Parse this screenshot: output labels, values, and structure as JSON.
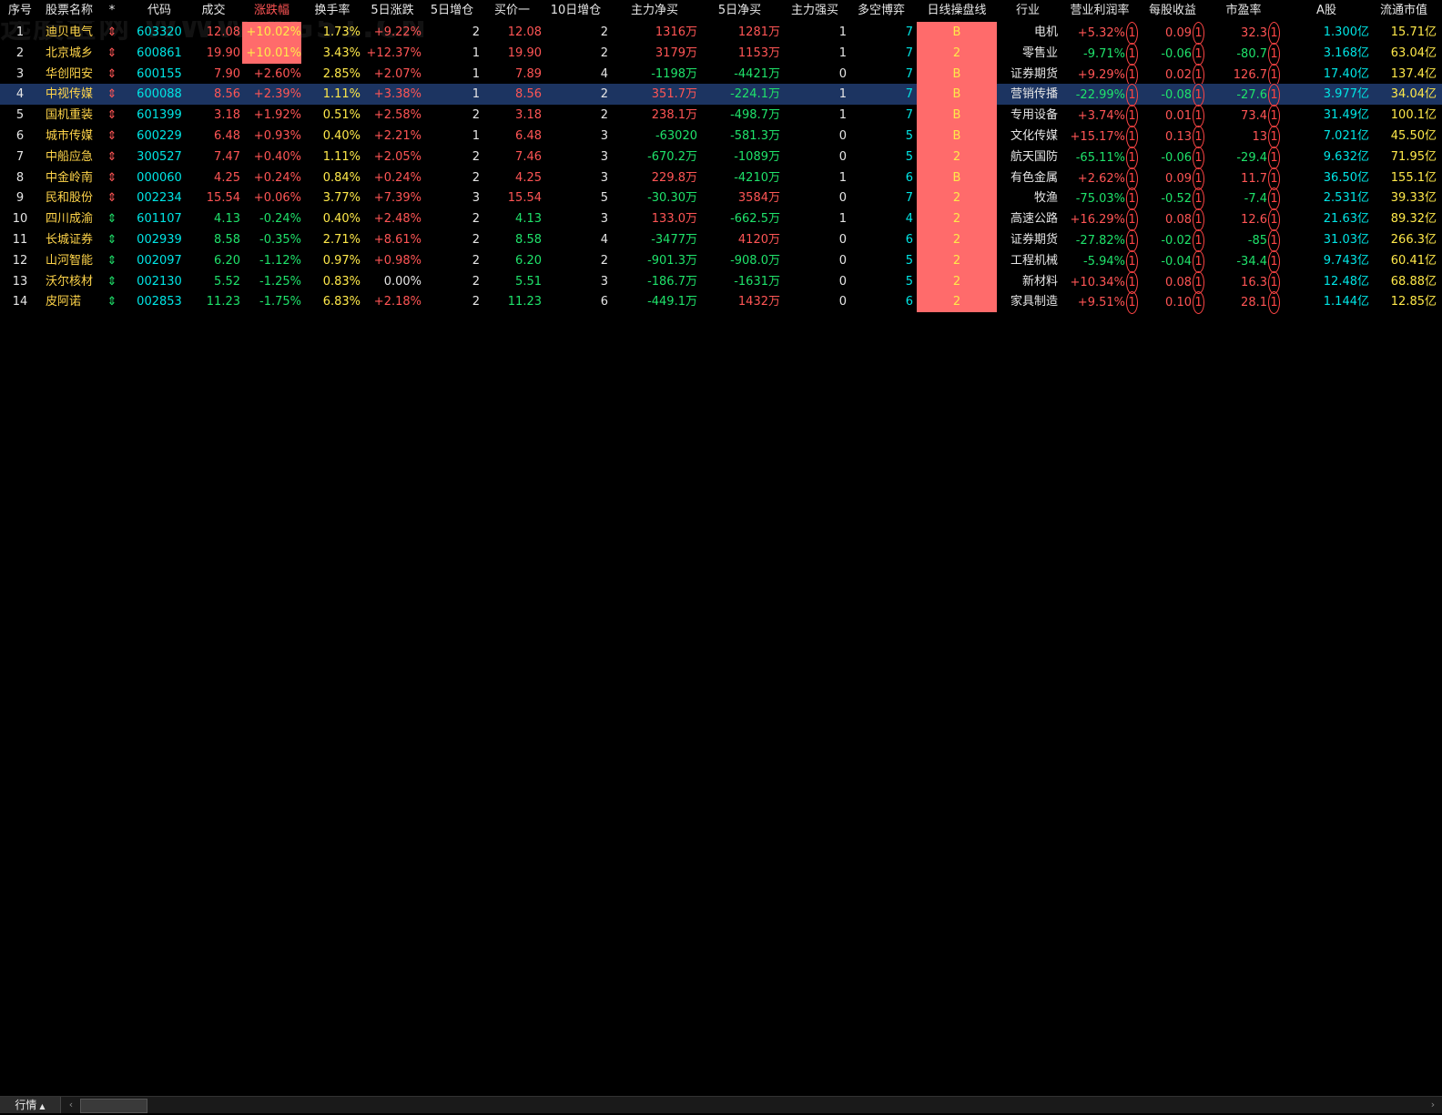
{
  "watermark": "选股宝网 WWW.XG51.CN",
  "headers": {
    "idx": "序号",
    "name": "股票名称",
    "star": "*",
    "code": "代码",
    "price": "成交",
    "chg": "涨跌幅",
    "turnover": "换手率",
    "chg5d": "5日涨跌",
    "add5d": "5日增仓",
    "bid1": "买价一",
    "add10d": "10日增仓",
    "main_net": "主力净买",
    "main_net5": "5日净买",
    "main_strong": "主力强买",
    "duokong": "多空博弈",
    "daily_line": "日线操盘线",
    "industry": "行业",
    "profit": "营业利润率",
    "eps": "每股收益",
    "pe": "市盈率",
    "a_share": "A股",
    "mkt_value": "流通市值"
  },
  "colors": {
    "up": "#ff5555",
    "down": "#1fe36b",
    "flat": "#e6e6e6",
    "highlight_bg": "#ff6b6b",
    "selected_row": "#1c3461"
  },
  "rows": [
    {
      "idx": "1",
      "name": "迪贝电气",
      "star": "⇕",
      "code": "603320",
      "price": "12.08",
      "chg": "+10.02%",
      "turnover": "1.73%",
      "chg5d": "+9.22%",
      "add5d": "2",
      "bid1": "12.08",
      "add10d": "2",
      "main_net": "1316万",
      "main_net5": "1281万",
      "main_strong": "1",
      "duokong": "7",
      "daily_line": "B",
      "industry": "电机",
      "profit": "+5.32%",
      "eps": "0.09",
      "pe": "32.3",
      "a_share": "1.300亿",
      "mkt_value": "15.71亿",
      "dir": "up",
      "hot": true
    },
    {
      "idx": "2",
      "name": "北京城乡",
      "star": "⇕",
      "code": "600861",
      "price": "19.90",
      "chg": "+10.01%",
      "turnover": "3.43%",
      "chg5d": "+12.37%",
      "add5d": "1",
      "bid1": "19.90",
      "add10d": "2",
      "main_net": "3179万",
      "main_net5": "1153万",
      "main_strong": "1",
      "duokong": "7",
      "daily_line": "2",
      "industry": "零售业",
      "profit": "-9.71%",
      "eps": "-0.06",
      "pe": "-80.7",
      "a_share": "3.168亿",
      "mkt_value": "63.04亿",
      "dir": "up",
      "hot": true
    },
    {
      "idx": "3",
      "name": "华创阳安",
      "star": "⇕",
      "code": "600155",
      "price": "7.90",
      "chg": "+2.60%",
      "turnover": "2.85%",
      "chg5d": "+2.07%",
      "add5d": "1",
      "bid1": "7.89",
      "add10d": "4",
      "main_net": "-1198万",
      "main_net5": "-4421万",
      "main_strong": "0",
      "duokong": "7",
      "daily_line": "B",
      "industry": "证券期货",
      "profit": "+9.29%",
      "eps": "0.02",
      "pe": "126.7",
      "a_share": "17.40亿",
      "mkt_value": "137.4亿",
      "dir": "up",
      "hot": false
    },
    {
      "idx": "4",
      "name": "中视传媒",
      "star": "⇕",
      "code": "600088",
      "price": "8.56",
      "chg": "+2.39%",
      "turnover": "1.11%",
      "chg5d": "+3.38%",
      "add5d": "1",
      "bid1": "8.56",
      "add10d": "2",
      "main_net": "351.7万",
      "main_net5": "-224.1万",
      "main_strong": "1",
      "duokong": "7",
      "daily_line": "B",
      "industry": "营销传播",
      "profit": "-22.99%",
      "eps": "-0.08",
      "pe": "-27.6",
      "a_share": "3.977亿",
      "mkt_value": "34.04亿",
      "dir": "up",
      "hot": false,
      "selected": true
    },
    {
      "idx": "5",
      "name": "国机重装",
      "star": "⇕",
      "code": "601399",
      "price": "3.18",
      "chg": "+1.92%",
      "turnover": "0.51%",
      "chg5d": "+2.58%",
      "add5d": "2",
      "bid1": "3.18",
      "add10d": "2",
      "main_net": "238.1万",
      "main_net5": "-498.7万",
      "main_strong": "1",
      "duokong": "7",
      "daily_line": "B",
      "industry": "专用设备",
      "profit": "+3.74%",
      "eps": "0.01",
      "pe": "73.4",
      "a_share": "31.49亿",
      "mkt_value": "100.1亿",
      "dir": "up",
      "hot": false
    },
    {
      "idx": "6",
      "name": "城市传媒",
      "star": "⇕",
      "code": "600229",
      "price": "6.48",
      "chg": "+0.93%",
      "turnover": "0.40%",
      "chg5d": "+2.21%",
      "add5d": "1",
      "bid1": "6.48",
      "add10d": "3",
      "main_net": "-63020",
      "main_net5": "-581.3万",
      "main_strong": "0",
      "duokong": "5",
      "daily_line": "B",
      "industry": "文化传媒",
      "profit": "+15.17%",
      "eps": "0.13",
      "pe": "13",
      "a_share": "7.021亿",
      "mkt_value": "45.50亿",
      "dir": "up",
      "hot": false
    },
    {
      "idx": "7",
      "name": "中船应急",
      "star": "⇕",
      "code": "300527",
      "price": "7.47",
      "chg": "+0.40%",
      "turnover": "1.11%",
      "chg5d": "+2.05%",
      "add5d": "2",
      "bid1": "7.46",
      "add10d": "3",
      "main_net": "-670.2万",
      "main_net5": "-1089万",
      "main_strong": "0",
      "duokong": "5",
      "daily_line": "2",
      "industry": "航天国防",
      "profit": "-65.11%",
      "eps": "-0.06",
      "pe": "-29.4",
      "a_share": "9.632亿",
      "mkt_value": "71.95亿",
      "dir": "up",
      "hot": false
    },
    {
      "idx": "8",
      "name": "中金岭南",
      "star": "⇕",
      "code": "000060",
      "price": "4.25",
      "chg": "+0.24%",
      "turnover": "0.84%",
      "chg5d": "+0.24%",
      "add5d": "2",
      "bid1": "4.25",
      "add10d": "3",
      "main_net": "229.8万",
      "main_net5": "-4210万",
      "main_strong": "1",
      "duokong": "6",
      "daily_line": "B",
      "industry": "有色金属",
      "profit": "+2.62%",
      "eps": "0.09",
      "pe": "11.7",
      "a_share": "36.50亿",
      "mkt_value": "155.1亿",
      "dir": "up",
      "hot": false
    },
    {
      "idx": "9",
      "name": "民和股份",
      "star": "⇕",
      "code": "002234",
      "price": "15.54",
      "chg": "+0.06%",
      "turnover": "3.77%",
      "chg5d": "+7.39%",
      "add5d": "3",
      "bid1": "15.54",
      "add10d": "5",
      "main_net": "-30.30万",
      "main_net5": "3584万",
      "main_strong": "0",
      "duokong": "7",
      "daily_line": "2",
      "industry": "牧渔",
      "profit": "-75.03%",
      "eps": "-0.52",
      "pe": "-7.4",
      "a_share": "2.531亿",
      "mkt_value": "39.33亿",
      "dir": "up",
      "hot": false
    },
    {
      "idx": "10",
      "name": "四川成渝",
      "star": "⇕",
      "code": "601107",
      "price": "4.13",
      "chg": "-0.24%",
      "turnover": "0.40%",
      "chg5d": "+2.48%",
      "add5d": "2",
      "bid1": "4.13",
      "add10d": "3",
      "main_net": "133.0万",
      "main_net5": "-662.5万",
      "main_strong": "1",
      "duokong": "4",
      "daily_line": "2",
      "industry": "高速公路",
      "profit": "+16.29%",
      "eps": "0.08",
      "pe": "12.6",
      "a_share": "21.63亿",
      "mkt_value": "89.32亿",
      "dir": "down",
      "hot": false
    },
    {
      "idx": "11",
      "name": "长城证券",
      "star": "⇕",
      "code": "002939",
      "price": "8.58",
      "chg": "-0.35%",
      "turnover": "2.71%",
      "chg5d": "+8.61%",
      "add5d": "2",
      "bid1": "8.58",
      "add10d": "4",
      "main_net": "-3477万",
      "main_net5": "4120万",
      "main_strong": "0",
      "duokong": "6",
      "daily_line": "2",
      "industry": "证券期货",
      "profit": "-27.82%",
      "eps": "-0.02",
      "pe": "-85",
      "a_share": "31.03亿",
      "mkt_value": "266.3亿",
      "dir": "down",
      "hot": false
    },
    {
      "idx": "12",
      "name": "山河智能",
      "star": "⇕",
      "code": "002097",
      "price": "6.20",
      "chg": "-1.12%",
      "turnover": "0.97%",
      "chg5d": "+0.98%",
      "add5d": "2",
      "bid1": "6.20",
      "add10d": "2",
      "main_net": "-901.3万",
      "main_net5": "-908.0万",
      "main_strong": "0",
      "duokong": "5",
      "daily_line": "2",
      "industry": "工程机械",
      "profit": "-5.94%",
      "eps": "-0.04",
      "pe": "-34.4",
      "a_share": "9.743亿",
      "mkt_value": "60.41亿",
      "dir": "down",
      "hot": false
    },
    {
      "idx": "13",
      "name": "沃尔核材",
      "star": "⇕",
      "code": "002130",
      "price": "5.52",
      "chg": "-1.25%",
      "turnover": "0.83%",
      "chg5d": "0.00%",
      "add5d": "2",
      "bid1": "5.51",
      "add10d": "3",
      "main_net": "-186.7万",
      "main_net5": "-1631万",
      "main_strong": "0",
      "duokong": "5",
      "daily_line": "2",
      "industry": "新材料",
      "profit": "+10.34%",
      "eps": "0.08",
      "pe": "16.3",
      "a_share": "12.48亿",
      "mkt_value": "68.88亿",
      "dir": "down",
      "hot": false
    },
    {
      "idx": "14",
      "name": "皮阿诺",
      "star": "⇕",
      "code": "002853",
      "price": "11.23",
      "chg": "-1.75%",
      "turnover": "6.83%",
      "chg5d": "+2.18%",
      "add5d": "2",
      "bid1": "11.23",
      "add10d": "6",
      "main_net": "-449.1万",
      "main_net5": "1432万",
      "main_strong": "0",
      "duokong": "6",
      "daily_line": "2",
      "industry": "家具制造",
      "profit": "+9.51%",
      "eps": "0.10",
      "pe": "28.1",
      "a_share": "1.144亿",
      "mkt_value": "12.85亿",
      "dir": "down",
      "hot": false
    }
  ],
  "statusbar": {
    "tab_label": "行情",
    "tab_caret": "▲",
    "left_arrow": "‹",
    "right_arrow": "›"
  }
}
